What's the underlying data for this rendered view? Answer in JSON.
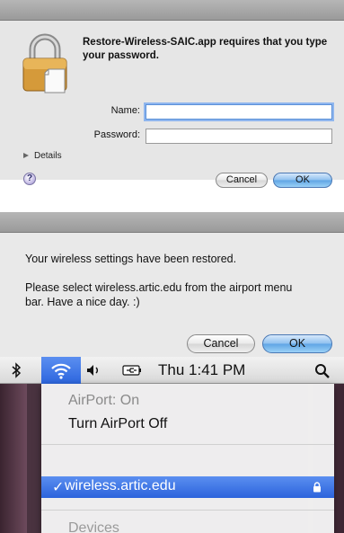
{
  "auth_dialog": {
    "message": "Restore-Wireless-SAIC.app requires that you type your password.",
    "name_label": "Name:",
    "name_value": "",
    "password_label": "Password:",
    "password_value": "",
    "details_label": "Details",
    "help_label": "?",
    "cancel_label": "Cancel",
    "ok_label": "OK"
  },
  "restored_dialog": {
    "message_line1": "Your wireless settings have been restored.",
    "message_line2": "Please select wireless.artic.edu from the airport menu bar. Have a nice day. :)",
    "cancel_label": "Cancel",
    "ok_label": "OK"
  },
  "menubar": {
    "bluetooth_icon": "bluetooth-icon",
    "wifi_icon": "wifi-icon",
    "volume_icon": "volume-icon",
    "battery_icon": "battery-icon",
    "clock": "Thu 1:41 PM",
    "spotlight_icon": "spotlight-icon"
  },
  "airport_menu": {
    "status": "AirPort: On",
    "toggle_label": "Turn AirPort Off",
    "selected_network": "wireless.artic.edu",
    "checkmark": "✓",
    "devices_label": "Devices"
  },
  "colors": {
    "selection_blue": "#2f68df",
    "ok_button_blue": "#6aaae6"
  }
}
